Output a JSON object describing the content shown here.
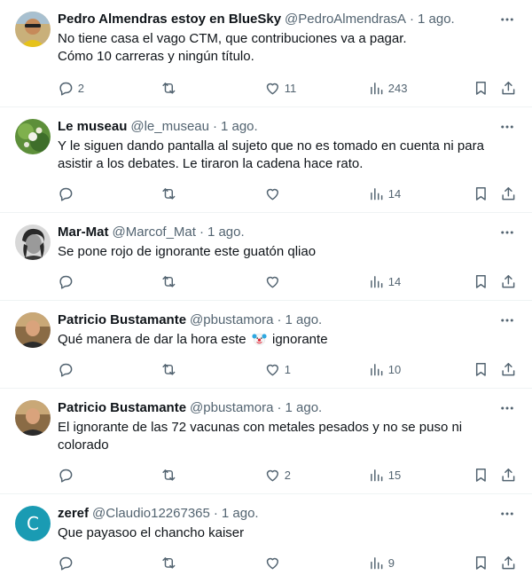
{
  "tweets": [
    {
      "name": "Pedro Almendras estoy en BlueSky",
      "handle": "@PedroAlmendrasA",
      "time": "1 ago.",
      "lines": [
        "No tiene casa el vago CTM, que contribuciones va a pagar.",
        "Cómo 10 carreras y ningún título."
      ],
      "replies": "2",
      "retweets": "",
      "likes": "11",
      "views": "243",
      "avatar": "photo-sunglasses"
    },
    {
      "name": "Le museau",
      "handle": "@le_museau",
      "time": "1 ago.",
      "lines": [
        "Y le siguen dando pantalla al sujeto que no es tomado en cuenta ni para",
        "asistir a los debates. Le tiraron la cadena hace rato."
      ],
      "replies": "",
      "retweets": "",
      "likes": "",
      "views": "14",
      "avatar": "photo-green-flowers"
    },
    {
      "name": "Mar-Mat",
      "handle": "@Marcof_Mat",
      "time": "1 ago.",
      "lines": [
        "Se pone rojo de ignorante este guatón qliao"
      ],
      "replies": "",
      "retweets": "",
      "likes": "",
      "views": "14",
      "avatar": "photo-bw-portrait"
    },
    {
      "name": "Patricio Bustamante",
      "handle": "@pbustamora",
      "time": "1 ago.",
      "lines_pre": "Qué manera de dar la hora este",
      "lines_post": "ignorante",
      "emoji": "clown-face-emoji",
      "replies": "",
      "retweets": "",
      "likes": "1",
      "views": "10",
      "avatar": "photo-man-portrait"
    },
    {
      "name": "Patricio Bustamante",
      "handle": "@pbustamora",
      "time": "1 ago.",
      "lines": [
        "El ignorante de las 72 vacunas con metales pesados y no se puso ni",
        "colorado"
      ],
      "replies": "",
      "retweets": "",
      "likes": "2",
      "views": "15",
      "avatar": "photo-man-portrait"
    },
    {
      "name": "zeref",
      "handle": "@Claudio12267365",
      "time": "1 ago.",
      "lines": [
        "Que payasoo el chancho kaiser"
      ],
      "replies": "",
      "retweets": "",
      "likes": "",
      "views": "9",
      "avatar_letter": "C",
      "avatar_color": "#1a9bb3"
    }
  ],
  "dot": "·",
  "colors": {
    "text": "#0f1419",
    "secondary": "#536471",
    "divider": "#eff3f4"
  }
}
